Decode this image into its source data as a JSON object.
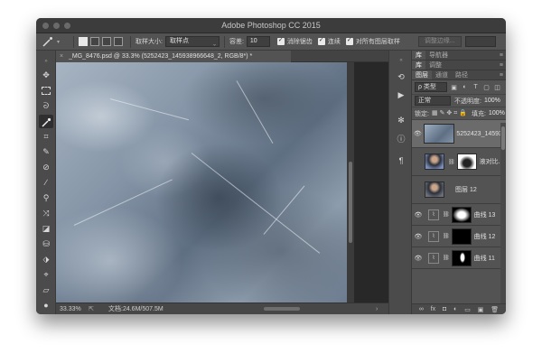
{
  "window": {
    "title": "Adobe Photoshop CC 2015"
  },
  "options_bar": {
    "sample_size_label": "取样大小:",
    "sample_size_value": "取样点",
    "tolerance_label": "容差:",
    "tolerance_value": "10",
    "anti_alias_label": "消除锯齿",
    "contiguous_label": "连续",
    "sample_all_layers_label": "对所有图层取样",
    "refine_edge_label": "调整边缘..."
  },
  "document": {
    "tab_title": "_MG_8476.psd @ 33.3% (5252423_145938966648_2, RGB/8*) *",
    "close_glyph": "×"
  },
  "status": {
    "zoom": "33.33%",
    "doc_size": "文档:24.6M/507.5M",
    "arrow": "›"
  },
  "panels": {
    "top_tabs": [
      "库",
      "导航器"
    ],
    "mid_tabs": [
      "库",
      "调整"
    ],
    "layers_tabs": [
      "图层",
      "通道",
      "路径"
    ],
    "filter_kind": "ρ 类型",
    "blend_mode": "正常",
    "opacity_label": "不透明度:",
    "opacity_value": "100%",
    "lock_label": "锁定:",
    "fill_label": "填充:",
    "fill_value": "100%",
    "menu_glyph": "≡",
    "layers": [
      {
        "name": "5252423_145938...",
        "visible": true
      },
      {
        "name": "液对比...",
        "visible": false
      },
      {
        "name": "图层 12",
        "visible": false
      },
      {
        "name": "曲线 13",
        "visible": true
      },
      {
        "name": "曲线 12",
        "visible": true
      },
      {
        "name": "曲线 11",
        "visible": true
      }
    ],
    "footer_icons": [
      "∞",
      "fx",
      "◘",
      "◐",
      "▭",
      "▣",
      "🗑"
    ]
  }
}
